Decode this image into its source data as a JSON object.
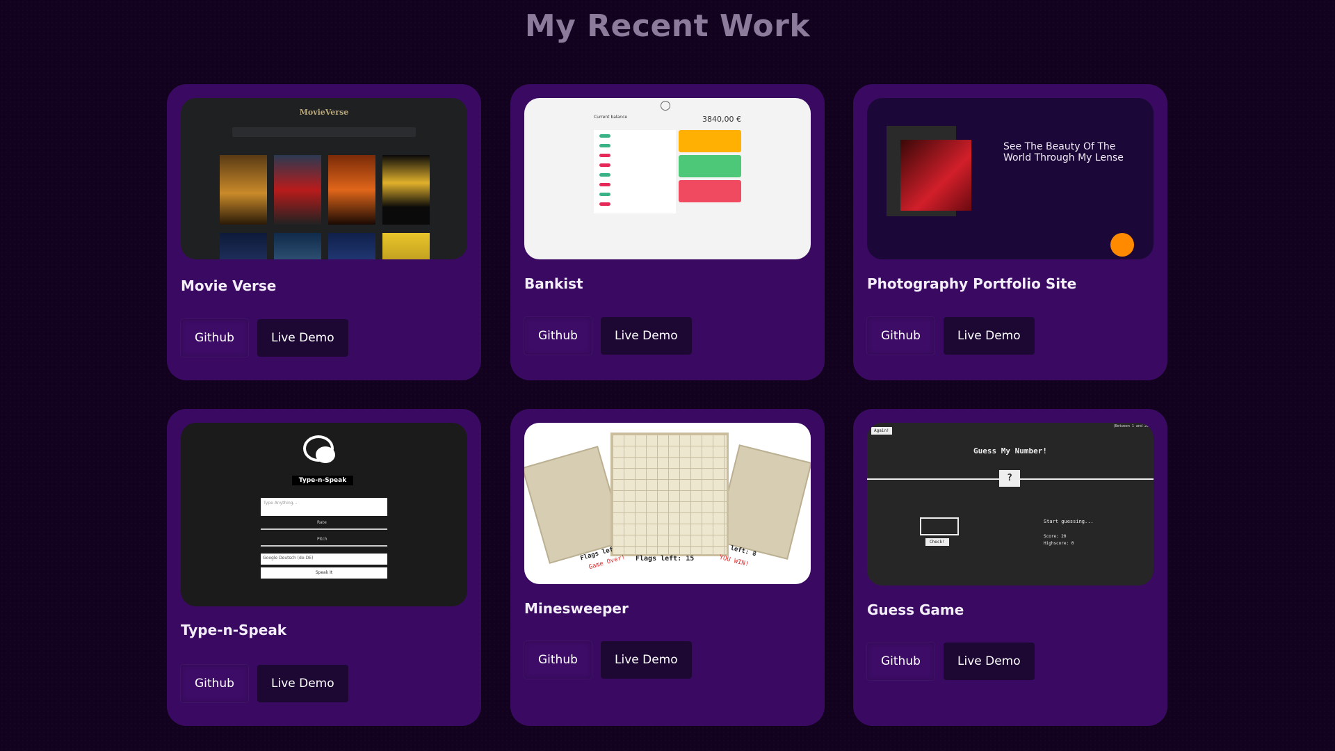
{
  "page": {
    "title": "My Recent Work"
  },
  "buttons": {
    "github": "Github",
    "demo": "Live Demo"
  },
  "projects": [
    {
      "title": "Movie Verse"
    },
    {
      "title": "Bankist"
    },
    {
      "title": "Photography Portfolio Site"
    },
    {
      "title": "Type-n-Speak"
    },
    {
      "title": "Minesweeper"
    },
    {
      "title": "Guess Game"
    }
  ],
  "thumbs": {
    "movieverse": {
      "logo": "MovieVerse"
    },
    "bankist": {
      "balance_label": "Current balance",
      "balance": "3840,00 €"
    },
    "photo": {
      "headline": "See The Beauty Of The World Through My Lense"
    },
    "typenspeak": {
      "app_name": "Type-n-Speak",
      "placeholder": "Type Anything...",
      "rate": "Rate",
      "pitch": "Pitch",
      "voice": "Google Deutsch (de-DE)",
      "speak": "Speak It"
    },
    "minesweeper": {
      "flags_left": "Flags left: 15",
      "flags_right": "left: 8",
      "game_over": "Game Over!",
      "you_win": "YOU WIN!",
      "flags_partial": "Flags lef"
    },
    "guess": {
      "again": "Again!",
      "title": "Guess My Number!",
      "mystery": "?",
      "start": "Start guessing...",
      "score": "Score: 20",
      "highscore": "Highscore: 0",
      "check": "Check!",
      "between": "(Between 1 and 20)"
    }
  },
  "colors": {
    "background": "#13021f",
    "card": "#3a0a62",
    "demo_button": "#1c0833"
  }
}
